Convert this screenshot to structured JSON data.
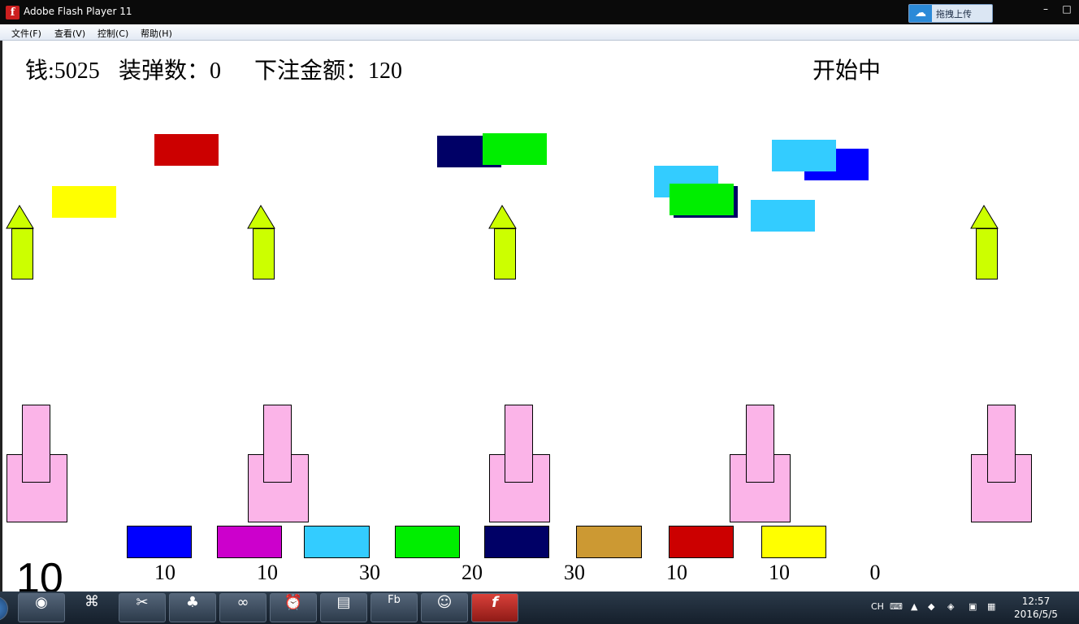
{
  "window": {
    "title": "Adobe Flash Player 11",
    "upload_button": "拖拽上传"
  },
  "menu": [
    "文件(F)",
    "查看(V)",
    "控制(C)",
    "帮助(H)"
  ],
  "hud": {
    "money": "钱:5025",
    "bullets": "装弹数：0",
    "bet": "下注金额：120",
    "status": "开始中"
  },
  "bet_targets": [
    {
      "color": "#0000ff",
      "odds": "10"
    },
    {
      "color": "#cc00cc",
      "odds": "10"
    },
    {
      "color": "#33ccff",
      "odds": "30"
    },
    {
      "color": "#00ee00",
      "odds": "20"
    },
    {
      "color": "#000066",
      "odds": "30"
    },
    {
      "color": "#cc9933",
      "odds": "10"
    },
    {
      "color": "#cc0000",
      "odds": "10"
    },
    {
      "color": "#ffff00",
      "odds": "10"
    }
  ],
  "extra_odds": "0",
  "countdown": "10",
  "flying_blocks": [
    "#cc0000",
    "#ffff00",
    "#000066",
    "#00ee00",
    "#33ccff",
    "#000066",
    "#00ee00",
    "#33ccff",
    "#0000ff",
    "#33ccff"
  ],
  "taskbar": {
    "apps": [
      "chrome-icon",
      "network-icon",
      "scissors-icon",
      "clover-icon",
      "visual-studio-icon",
      "alarm-icon",
      "notes-icon",
      "flash-builder-icon",
      "qq-icon",
      "flash-player-icon"
    ],
    "fb_label": "Fb",
    "flash_label": "f",
    "lang": "CH",
    "time": "12:57",
    "date": "2016/5/5"
  }
}
